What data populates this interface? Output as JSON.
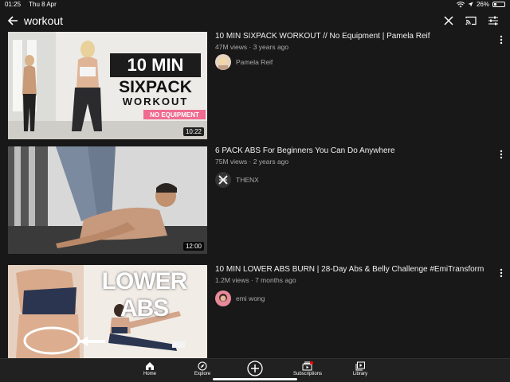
{
  "status": {
    "time": "01:25",
    "date": "Thu 8 Apr",
    "battery": "26%",
    "battery_level": 0.26
  },
  "search": {
    "query": "workout"
  },
  "videos": [
    {
      "title": "10 MIN SIXPACK WORKOUT // No Equipment | Pamela Reif",
      "stats": "47M views · 3 years ago",
      "channel": "Pamela Reif",
      "duration": "10:22",
      "thumb_line1": "10 MIN",
      "thumb_line2": "SIXPACK",
      "thumb_line3": "WORKOUT",
      "thumb_tag": "NO EQUIPMENT"
    },
    {
      "title": "6 PACK ABS For Beginners You Can Do Anywhere",
      "stats": "75M views · 2 years ago",
      "channel": "THENX",
      "duration": "12:00"
    },
    {
      "title": "10 MIN LOWER ABS BURN | 28-Day Abs & Belly Challenge #EmiTransform",
      "stats": "1.2M views · 7 months ago",
      "channel": "emi wong",
      "thumb_text": "LOWER ABS"
    }
  ],
  "nav": [
    {
      "label": "Home",
      "icon": "home-icon"
    },
    {
      "label": "Explore",
      "icon": "compass-icon"
    },
    {
      "label": "",
      "icon": "add-icon"
    },
    {
      "label": "Subscriptions",
      "icon": "subscriptions-icon"
    },
    {
      "label": "Library",
      "icon": "library-icon"
    }
  ],
  "colors": {
    "background": "#181818",
    "nav_bg": "#212121",
    "accent_red": "#ff0000",
    "tag_pink": "#f06b8f"
  }
}
